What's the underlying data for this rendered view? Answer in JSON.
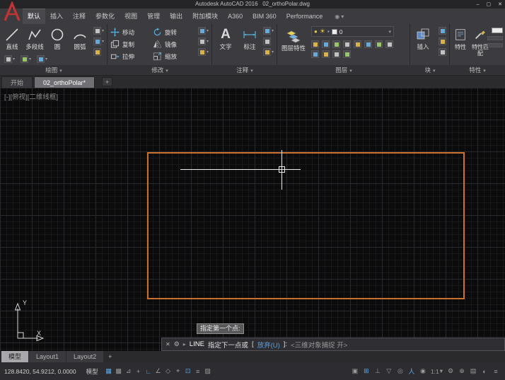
{
  "window": {
    "title": "Autodesk AutoCAD 2016   02_orthoPolar.dwg",
    "minimize": "–",
    "maximize": "▢",
    "close": "✕"
  },
  "glyphs": {
    "caret_down": "▾",
    "bulb": "●",
    "sun": "☀",
    "lock": "▪",
    "text_tool": "A",
    "ribbon_toggle": "◉"
  },
  "ribbon": {
    "tabs": [
      "默认",
      "插入",
      "注释",
      "参数化",
      "视图",
      "管理",
      "输出",
      "附加模块",
      "A360",
      "BIM 360",
      "Performance"
    ],
    "panels": {
      "draw": {
        "label": "绘图",
        "line": "直线",
        "polyline": "多段线",
        "circle": "圆",
        "arc": "圆弧"
      },
      "modify": {
        "label": "修改",
        "move": "移动",
        "rotate": "旋转",
        "copy": "复制",
        "mirror": "镜像",
        "stretch": "拉伸",
        "scale": "缩放"
      },
      "annotation": {
        "label": "注释",
        "text": "文字",
        "dimension": "标注"
      },
      "layers": {
        "label": "图层",
        "layer_properties": "图层特性",
        "current_layer": "0"
      },
      "block": {
        "label": "块",
        "insert": "插入"
      },
      "properties": {
        "label": "特性",
        "properties": "特性",
        "match": "特性匹配"
      }
    }
  },
  "file_tabs": {
    "start": "开始",
    "drawing": "02_orthoPolar*",
    "new_tab": "+"
  },
  "canvas": {
    "viewport_controls": "[-][俯视][二维线框]",
    "tooltip": "指定第一个点:",
    "ucs_x": "X",
    "ucs_y": "Y"
  },
  "command_line": {
    "close": "✕",
    "customize": "⚙",
    "caret": "▸",
    "command": "LINE",
    "prompt": "指定下一点或",
    "bracket_open": "[",
    "option": "放弃(U)",
    "bracket_close": "]:",
    "hint": "<三维对象捕捉 开>"
  },
  "layout_tabs": {
    "model": "模型",
    "layout1": "Layout1",
    "layout2": "Layout2",
    "new_tab": "+"
  },
  "status_bar": {
    "coordinates": "128.8420, 54.9212, 0.0000",
    "model_label": "模型",
    "annotation_scale": "1:1",
    "left_icons": [
      "▦",
      "▩",
      "⊿",
      "+",
      "∟",
      "∠",
      "◇",
      "⌖",
      "⊡",
      "≡",
      "▨"
    ],
    "right_icons": [
      "▣",
      "⊞",
      "⊥",
      "▽",
      "◎",
      "人",
      "◉",
      "⚙",
      "⊕",
      "▤",
      "◐",
      "≡"
    ]
  },
  "colors": {
    "rect_orange": "#c9702e",
    "active_blue": "#5aa9e6",
    "canvas_bg": "#0b0b0c"
  }
}
